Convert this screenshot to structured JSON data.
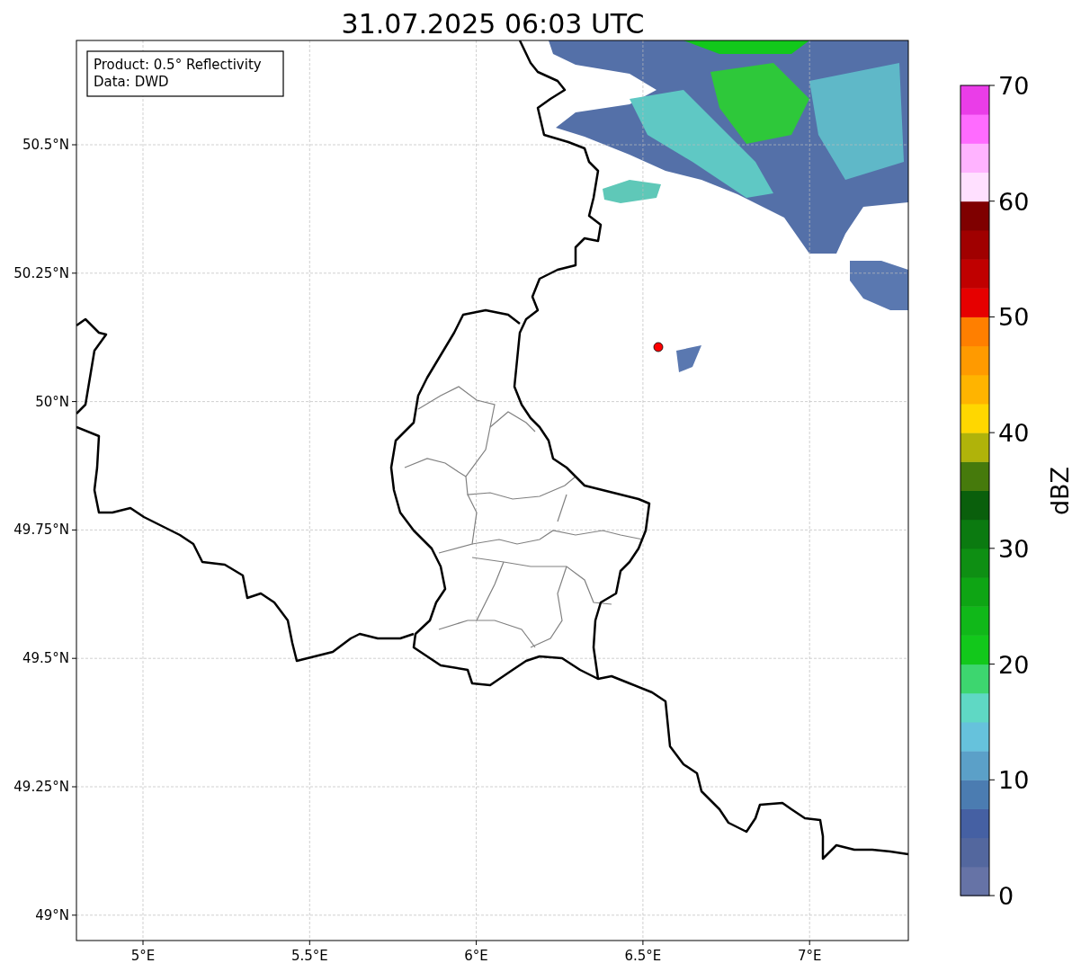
{
  "title": "31.07.2025 06:03 UTC",
  "info_box": [
    "Product: 0.5° Reflectivity",
    "Data: DWD"
  ],
  "map": {
    "y_ticks": [
      "50.5°N",
      "50.25°N",
      "50°N",
      "49.75°N",
      "49.5°N",
      "49.25°N",
      "49°N"
    ],
    "x_ticks": [
      "5°E",
      "5.5°E",
      "6°E",
      "6.5°E",
      "7°E"
    ]
  },
  "colorbar": {
    "label": "dBZ",
    "ticks": [
      "70",
      "60",
      "50",
      "40",
      "30",
      "20",
      "10",
      "0"
    ],
    "segments": [
      {
        "color": "#6673a6"
      },
      {
        "color": "#53679e"
      },
      {
        "color": "#4560a3"
      },
      {
        "color": "#4b7cb1"
      },
      {
        "color": "#5ba0c8"
      },
      {
        "color": "#66c2dc"
      },
      {
        "color": "#5fd8c4"
      },
      {
        "color": "#3dd66f"
      },
      {
        "color": "#12c81b"
      },
      {
        "color": "#10b819"
      },
      {
        "color": "#0ea514"
      },
      {
        "color": "#0e8f13"
      },
      {
        "color": "#0b7a10"
      },
      {
        "color": "#0a5f0c"
      },
      {
        "color": "#467a0c"
      },
      {
        "color": "#b0b30a"
      },
      {
        "color": "#ffd700"
      },
      {
        "color": "#ffb400"
      },
      {
        "color": "#ff9a00"
      },
      {
        "color": "#ff7f00"
      },
      {
        "color": "#e60000"
      },
      {
        "color": "#c00000"
      },
      {
        "color": "#a00000"
      },
      {
        "color": "#7f0000"
      },
      {
        "color": "#ffe0ff"
      },
      {
        "color": "#ffb3ff"
      },
      {
        "color": "#ff6bff"
      },
      {
        "color": "#ea3de8"
      }
    ]
  }
}
